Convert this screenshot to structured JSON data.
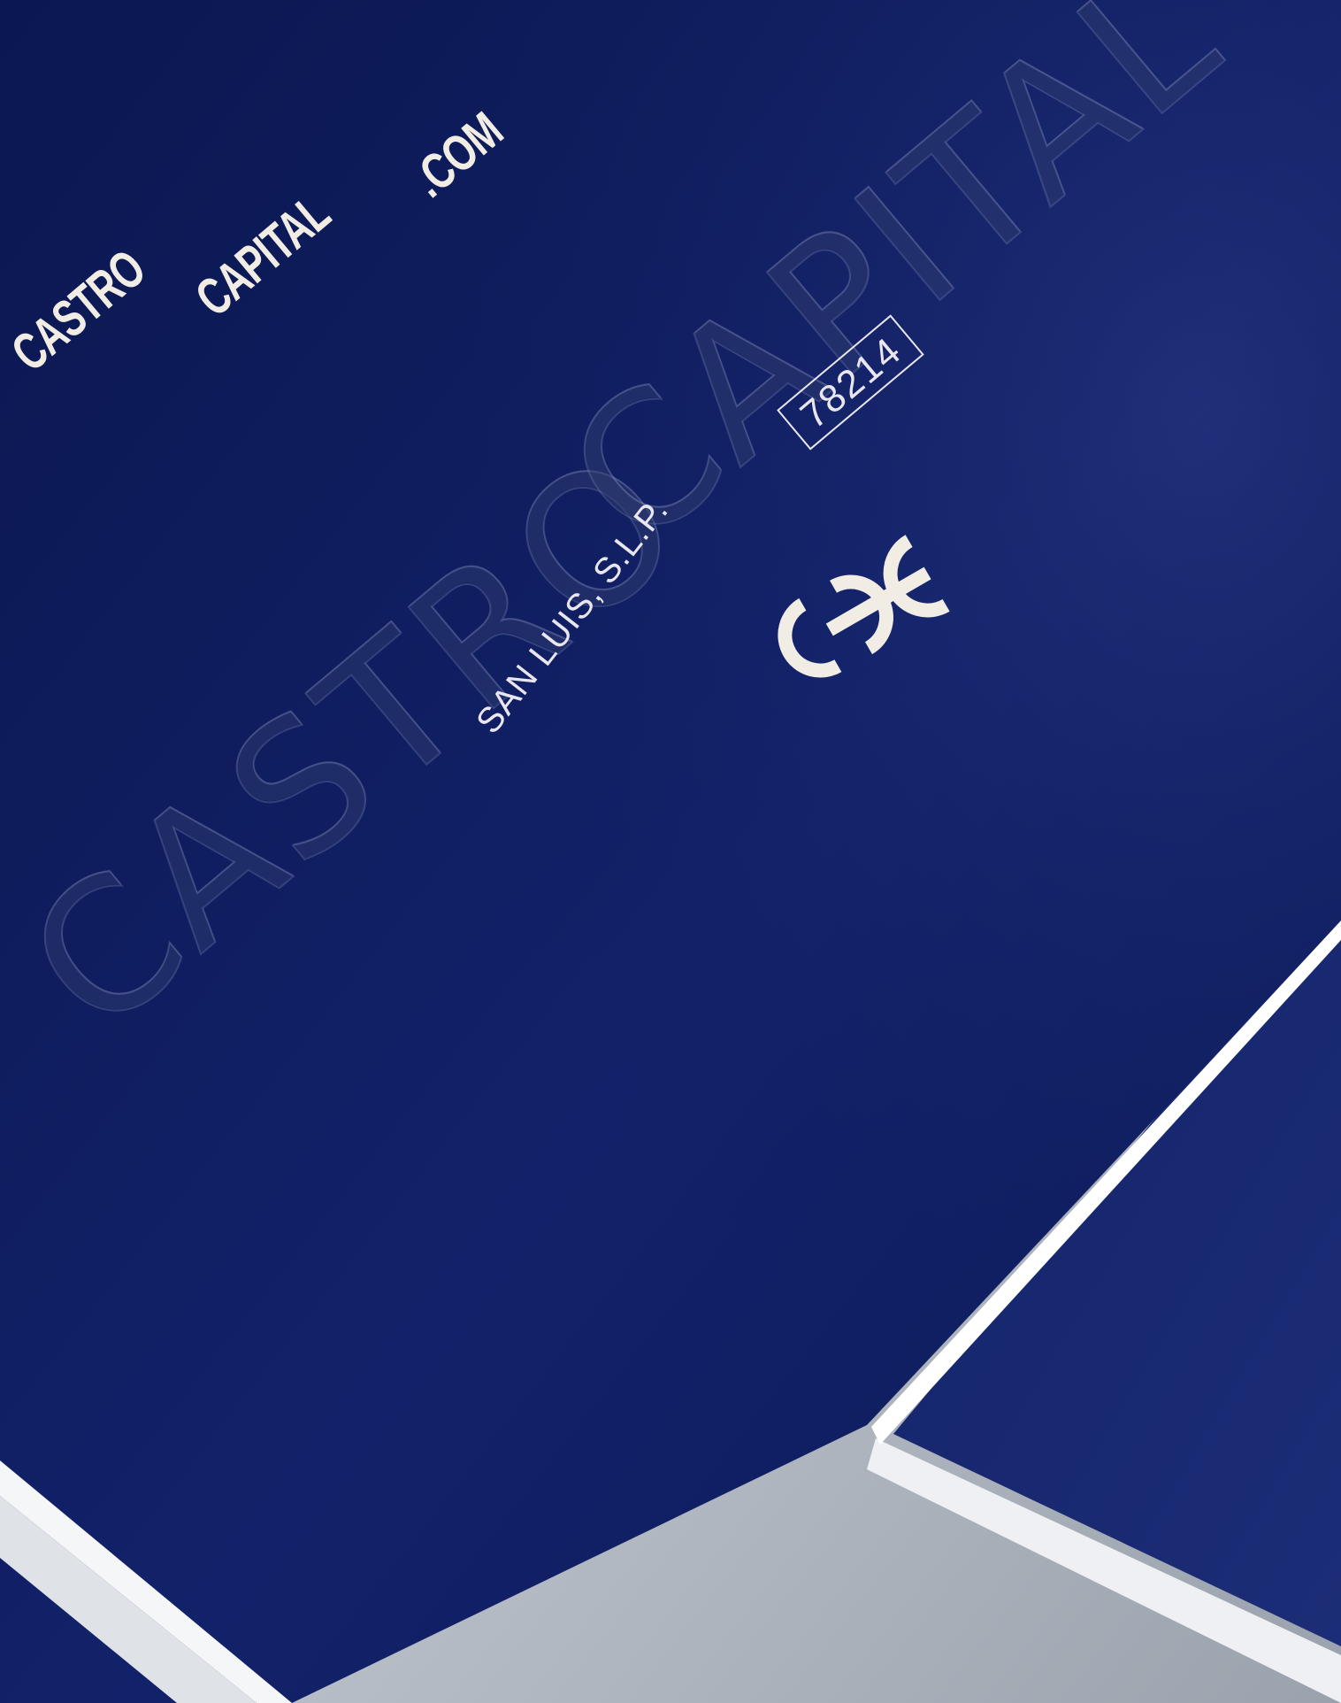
{
  "card": {
    "condensed_words": [
      "CASTRO",
      "CAPITAL",
      ".COM"
    ],
    "embossed_word_1": "CASTRO",
    "embossed_word_2": "CAPITAL",
    "city": "SAN LUIS, S.L.P.",
    "postal_code": "78214",
    "monogram_icon": "ooc-monogram-icon"
  },
  "colors": {
    "card_navy": "#0f1d5c",
    "ink_cream": "#f1ede4",
    "edge_white": "#ffffff",
    "surface_grey": "#c9ced6"
  }
}
